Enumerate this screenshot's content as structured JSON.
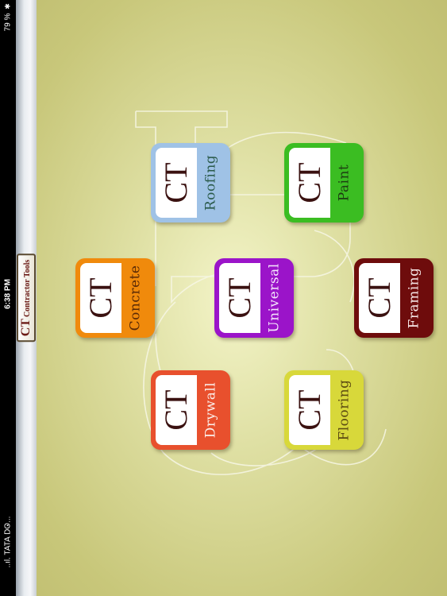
{
  "status_bar": {
    "carrier": "..ıl. TATA DO...",
    "time": "6:38 PM",
    "battery": "79 %"
  },
  "app": {
    "title_ct": "CT",
    "title_rest": "Contractor Tools"
  },
  "tiles": [
    {
      "id": "roofing",
      "ct": "CT",
      "label": "Roofing",
      "bg": "#9fc2e6",
      "label_color": "#2a5a4a"
    },
    {
      "id": "paint",
      "ct": "CT",
      "label": "Paint",
      "bg": "#3bbd22",
      "label_color": "#1d3d12"
    },
    {
      "id": "concrete",
      "ct": "CT",
      "label": "Concrete",
      "bg": "#f08a0c",
      "label_color": "#5a2a06"
    },
    {
      "id": "universal",
      "ct": "CT",
      "label": "Universal",
      "bg": "#9b14c9",
      "label_color": "#f4e6fb"
    },
    {
      "id": "framing",
      "ct": "CT",
      "label": "Framing",
      "bg": "#6e0c0c",
      "label_color": "#f6e8e8"
    },
    {
      "id": "drywall",
      "ct": "CT",
      "label": "Drywall",
      "bg": "#e8502d",
      "label_color": "#fbeee9"
    },
    {
      "id": "flooring",
      "ct": "CT",
      "label": "Flooring",
      "bg": "#d8d83a",
      "label_color": "#5b4a12"
    }
  ]
}
